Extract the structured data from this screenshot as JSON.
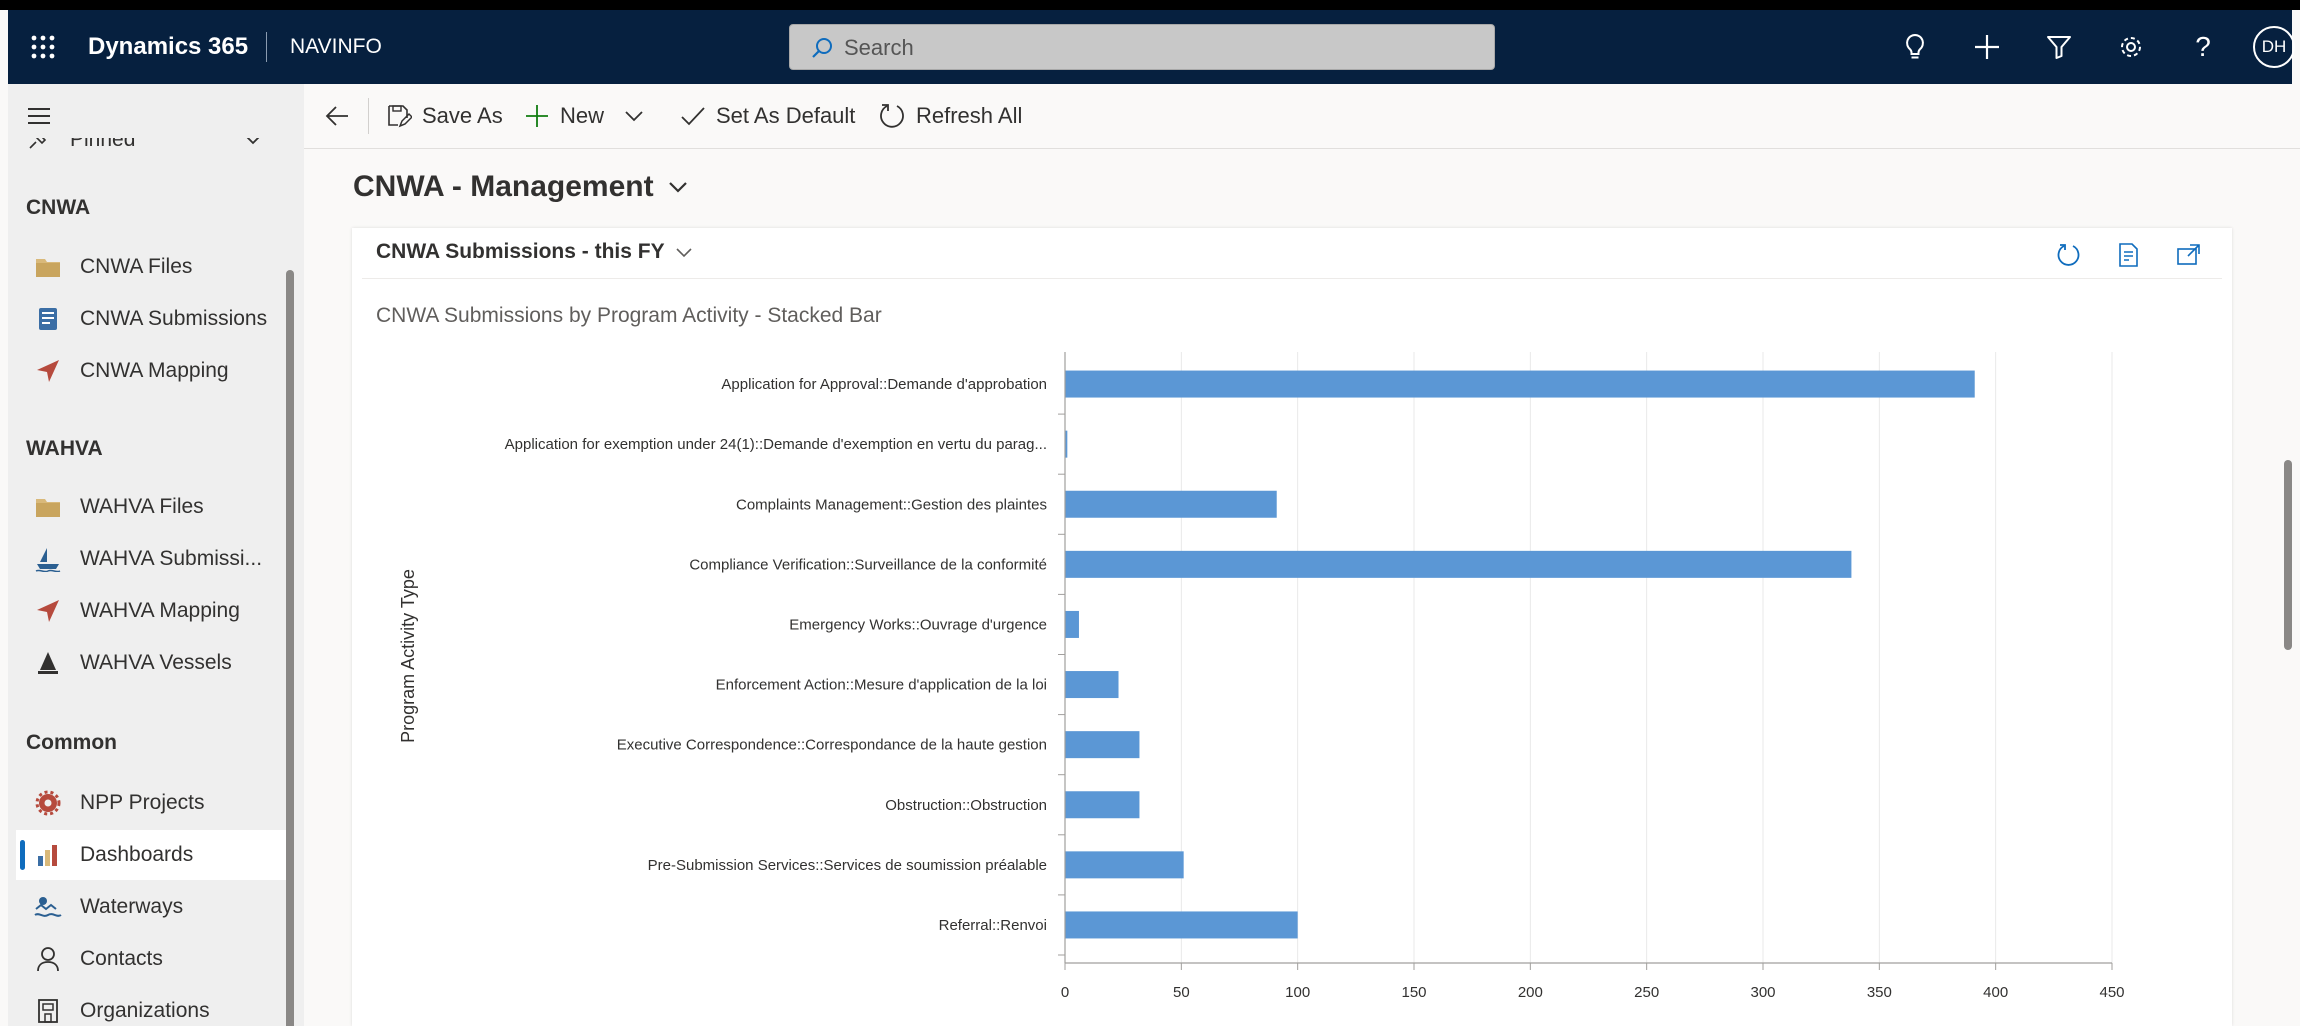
{
  "topbar": {
    "app_name": "Dynamics 365",
    "org_name": "NAVINFO",
    "search_placeholder": "Search",
    "avatar_initials": "DH",
    "icons": [
      "waffle-icon",
      "search-icon",
      "lightbulb-icon",
      "plus-icon",
      "filter-icon",
      "gear-icon",
      "help-icon"
    ]
  },
  "sidebar": {
    "pinned_label": "Pinned",
    "groups": [
      {
        "title": "CNWA",
        "items": [
          {
            "label": "CNWA Files",
            "icon": "folder-icon"
          },
          {
            "label": "CNWA Submissions",
            "icon": "document-icon"
          },
          {
            "label": "CNWA Mapping",
            "icon": "navigation-arrow-icon"
          }
        ]
      },
      {
        "title": "WAHVA",
        "items": [
          {
            "label": "WAHVA Files",
            "icon": "folder-icon"
          },
          {
            "label": "WAHVA Submissi...",
            "icon": "boat-icon"
          },
          {
            "label": "WAHVA Mapping",
            "icon": "navigation-arrow-icon"
          },
          {
            "label": "WAHVA Vessels",
            "icon": "sailboat-icon"
          }
        ]
      },
      {
        "title": "Common",
        "items": [
          {
            "label": "NPP Projects",
            "icon": "gear-red-icon"
          },
          {
            "label": "Dashboards",
            "icon": "bar-chart-icon",
            "active": true
          },
          {
            "label": "Waterways",
            "icon": "waves-icon"
          },
          {
            "label": "Contacts",
            "icon": "person-icon"
          },
          {
            "label": "Organizations",
            "icon": "building-icon"
          }
        ]
      }
    ]
  },
  "commandbar": {
    "save_as": "Save As",
    "new": "New",
    "set_default": "Set As Default",
    "refresh_all": "Refresh All"
  },
  "dashboard": {
    "title": "CNWA - Management",
    "view_title": "CNWA Submissions - this FY"
  },
  "colors": {
    "topbar": "#06203f",
    "bar": "#5b97d5",
    "accent": "#0f6cbd"
  },
  "chart_data": {
    "type": "bar",
    "orientation": "horizontal",
    "title": "CNWA Submissions by Program Activity - Stacked Bar",
    "ylabel": "Program Activity Type",
    "xlabel": "",
    "categories": [
      "Application for Approval::Demande d'approbation",
      "Application for exemption under 24(1)::Demande d'exemption en vertu du parag...",
      "Complaints Management::Gestion des plaintes",
      "Compliance Verification::Surveillance de la conformité",
      "Emergency Works::Ouvrage d'urgence",
      "Enforcement Action::Mesure d'application de la loi",
      "Executive Correspondence::Correspondance de la haute gestion",
      "Obstruction::Obstruction",
      "Pre-Submission Services::Services de soumission préalable",
      "Referral::Renvoi"
    ],
    "values": [
      391,
      1,
      91,
      338,
      6,
      23,
      32,
      32,
      51,
      100
    ],
    "xlim": [
      0,
      450
    ],
    "xticks": [
      0,
      50,
      100,
      150,
      200,
      250,
      300,
      350,
      400,
      450
    ],
    "grid": true
  }
}
